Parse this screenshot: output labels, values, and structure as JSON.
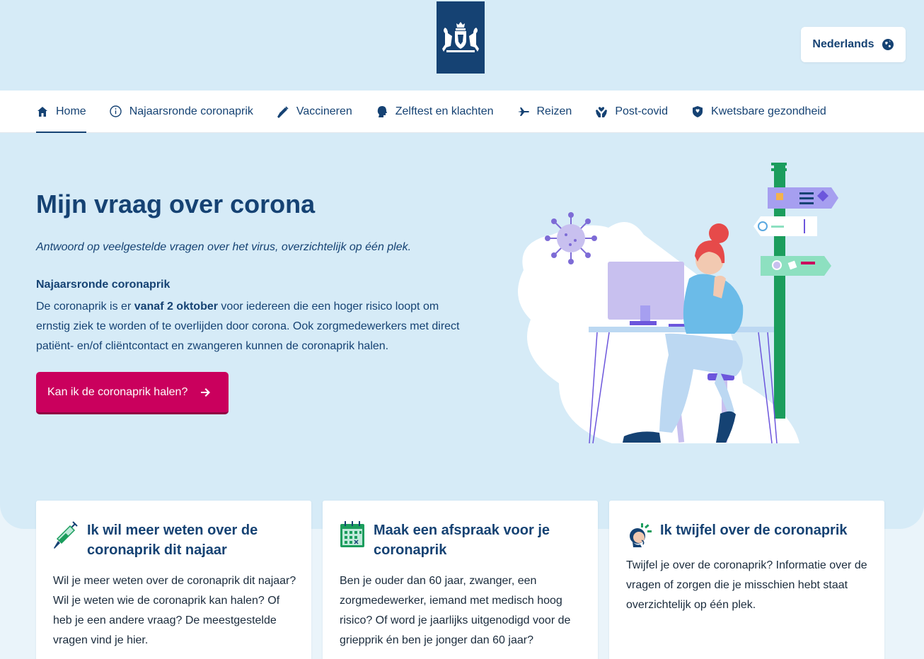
{
  "header": {
    "language_label": "Nederlands",
    "language_icon": "globe-icon"
  },
  "nav": {
    "items": [
      {
        "label": "Home",
        "icon": "home-icon"
      },
      {
        "label": "Najaarsronde coronaprik",
        "icon": "info-icon"
      },
      {
        "label": "Vaccineren",
        "icon": "syringe-icon"
      },
      {
        "label": "Zelftest en klachten",
        "icon": "head-icon"
      },
      {
        "label": "Reizen",
        "icon": "airplane-icon"
      },
      {
        "label": "Post-covid",
        "icon": "hands-heart-icon"
      },
      {
        "label": "Kwetsbare gezondheid",
        "icon": "shield-icon"
      }
    ]
  },
  "hero": {
    "title": "Mijn vraag over corona",
    "subtitle": "Antwoord op veelgestelde vragen over het virus, overzichtelijk op één plek.",
    "section_title": "Najaarsronde coronaprik",
    "text_before": "De coronaprik is er ",
    "text_bold": "vanaf 2 oktober",
    "text_after": " voor iedereen die een hoger risico loopt om ernstig ziek te worden of te overlijden door corona. Ook zorgmedewerkers met direct patiënt- en/of cliëntcontact en zwangeren kunnen de coronaprik halen.",
    "cta_label": "Kan ik de coronaprik halen?"
  },
  "cards": [
    {
      "title": "Ik wil meer weten over de coronaprik dit najaar",
      "body": "Wil je meer weten over de coronaprik dit najaar? Wil je weten wie de coronaprik kan halen? Of heb je een andere vraag? De meestgestelde vragen vind je hier.",
      "icon": "syringe-icon"
    },
    {
      "title": "Maak een afspraak voor je coronaprik",
      "body": "Ben je ouder dan 60 jaar, zwanger, een zorgmedewerker, iemand met medisch hoog risico? Of word je jaarlijks uitgenodigd voor de griepprik én ben je jonger dan 60 jaar?",
      "icon": "calendar-icon"
    },
    {
      "title": "Ik twijfel over de coronaprik",
      "body": "Twijfel je over de coronaprik? Informatie over de vragen of zorgen die je misschien hebt staat overzichtelijk op één plek.",
      "icon": "doubting-person-icon"
    }
  ],
  "colors": {
    "primary": "#154273",
    "accent": "#ca005d",
    "hero_bg": "#d6ebf7",
    "page_bg": "#eaf4fa"
  }
}
